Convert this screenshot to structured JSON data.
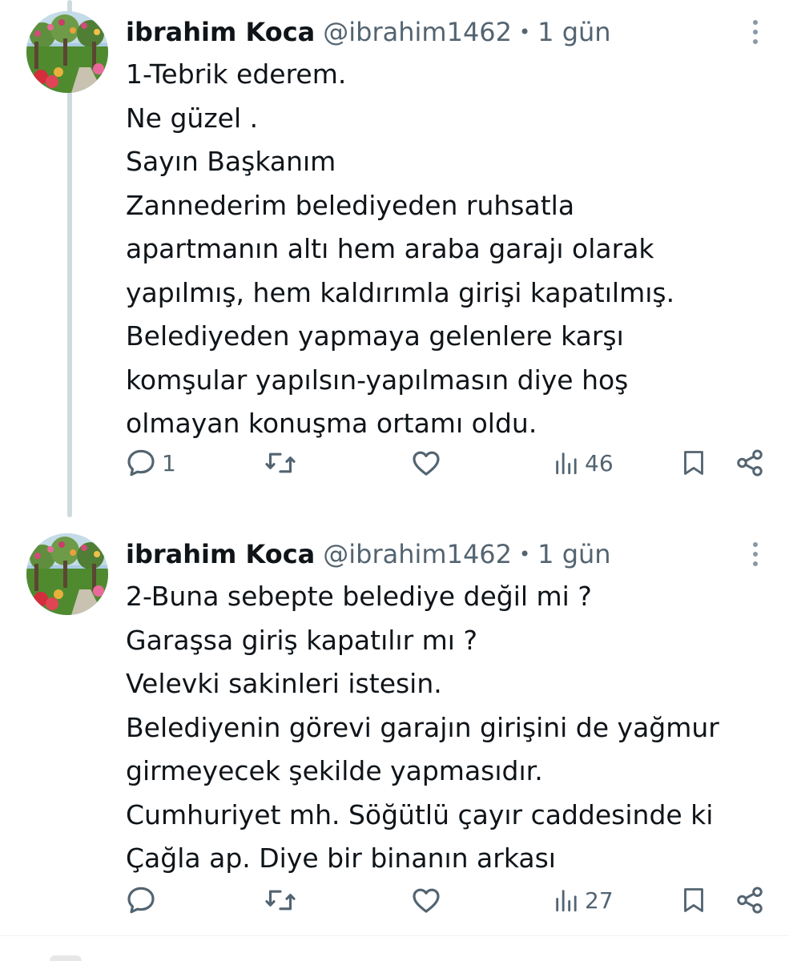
{
  "tweets": [
    {
      "display_name": "ibrahim Koca",
      "handle": "@ibrahim1462",
      "separator": "•",
      "time": "1 gün",
      "lines": [
        "1-Tebrik ederem.",
        "Ne güzel .",
        "Sayın Başkanım",
        "Zannederim belediyeden ruhsatla",
        "apartmanın altı hem araba garajı olarak",
        "yapılmış, hem kaldırımla girişi kapatılmış.",
        "Belediyeden yapmaya gelenlere karşı",
        "komşular yapılsın-yapılmasın diye hoş",
        "olmayan konuşma ortamı oldu."
      ],
      "reply_count": "1",
      "retweet_count": "",
      "like_count": "",
      "views_count": "46"
    },
    {
      "display_name": "ibrahim Koca",
      "handle": "@ibrahim1462",
      "separator": "•",
      "time": "1 gün",
      "lines": [
        "2-Buna sebepte belediye değil mi ?",
        "Garaşsa giriş kapatılır mı ?",
        "Velevki sakinleri istesin.",
        "Belediyenin görevi garajın girişini de yağmur",
        "girmeyecek şekilde yapmasıdır.",
        "Cumhuriyet mh. Söğütlü çayır caddesinde ki",
        "Çağla ap. Diye bir binanın arkası"
      ],
      "reply_count": "",
      "retweet_count": "",
      "like_count": "",
      "views_count": "27"
    }
  ],
  "icons": {
    "avatar": "garden-flowers-avatar",
    "more": "more-vertical-icon",
    "reply": "reply-icon",
    "retweet": "retweet-icon",
    "like": "heart-icon",
    "views": "views-bar-chart-icon",
    "bookmark": "bookmark-icon",
    "share": "share-icon"
  },
  "colors": {
    "text_primary": "#0f1419",
    "text_secondary": "#536471",
    "thread_line": "#cfd9de",
    "background": "#ffffff"
  }
}
